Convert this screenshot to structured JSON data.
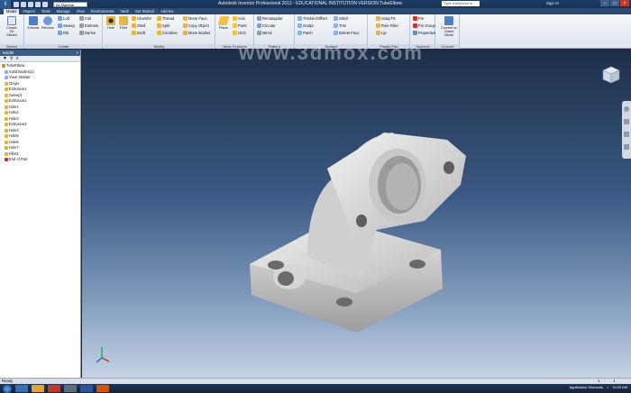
{
  "titlebar": {
    "app_button": "I",
    "material": "As Material",
    "title": "Autodesk Inventor Professional 2012 - EDUCATIONAL INSTITUTION VERSION    TubeElbow",
    "search_placeholder": "Type a keyword or phrase",
    "signin": "Sign In"
  },
  "tabs": [
    "Model",
    "Inspect",
    "Tools",
    "Manage",
    "View",
    "Environments",
    "Vault",
    "Get Started",
    "Add-Ins"
  ],
  "ribbon": {
    "sketch": {
      "label": "Sketch",
      "create_label": "Create 2D Sketch"
    },
    "create": {
      "label": "Create",
      "extrude": "Extrude",
      "revolve": "Revolve",
      "loft": "Loft",
      "sweep": "Sweep",
      "rib": "Rib",
      "coil": "Coil",
      "emboss": "Emboss",
      "derive": "Derive"
    },
    "modify": {
      "label": "Modify",
      "hole": "Hole",
      "fillet": "Fillet",
      "chamfer": "Chamfer",
      "shell": "Shell",
      "draft": "Draft",
      "thread": "Thread",
      "split": "Split",
      "combine": "Combine",
      "move_face": "Move Face",
      "copy_object": "Copy Object",
      "move_bodies": "Move Bodies"
    },
    "work": {
      "label": "Work Features",
      "plane": "Plane",
      "axis": "Axis",
      "point": "Point",
      "ucs": "UCS"
    },
    "pattern": {
      "label": "Pattern",
      "rectangular": "Rectangular",
      "circular": "Circular",
      "mirror": "Mirror"
    },
    "surface": {
      "label": "Surface",
      "thicken": "Thicken/Offset",
      "stitch": "Stitch",
      "trim": "Trim",
      "sculpt": "Sculpt",
      "patch": "Patch",
      "delete_face": "Delete Face"
    },
    "plastic": {
      "label": "Plastic Part",
      "snap_fit": "Snap Fit",
      "rule_fillet": "Rule Fillet",
      "lip": "Lip"
    },
    "harness": {
      "label": "Harness",
      "pin": "Pin",
      "pin_group": "Pin Group",
      "properties": "Properties"
    },
    "convert": {
      "label": "Convert",
      "sheet_metal": "Convert to Sheet Metal"
    }
  },
  "browser": {
    "title": "Model",
    "nodes": [
      "TubeElbow",
      "Solid Bodies(1)",
      "View: Master",
      "Origin",
      "Extrusion1",
      "Sweep1",
      "Extrusion2",
      "Hole1",
      "Hole2",
      "Hole3",
      "Extrusion3",
      "Hole4",
      "Hole5",
      "Hole6",
      "Hole7",
      "Fillet1",
      "End of Part"
    ]
  },
  "viewport": {
    "watermark": "www.3dmox.com"
  },
  "status": {
    "text": "Ready",
    "page_a": "1",
    "page_b": "1"
  },
  "taskbar": {
    "tray_label": "Application Shortcuts",
    "clock": "10:20 AM"
  },
  "colors": {
    "accent": "#2a4a73",
    "viewport_top": "#1d2f48",
    "viewport_bottom": "#c5d3e4",
    "part": "#d8d8d8"
  }
}
